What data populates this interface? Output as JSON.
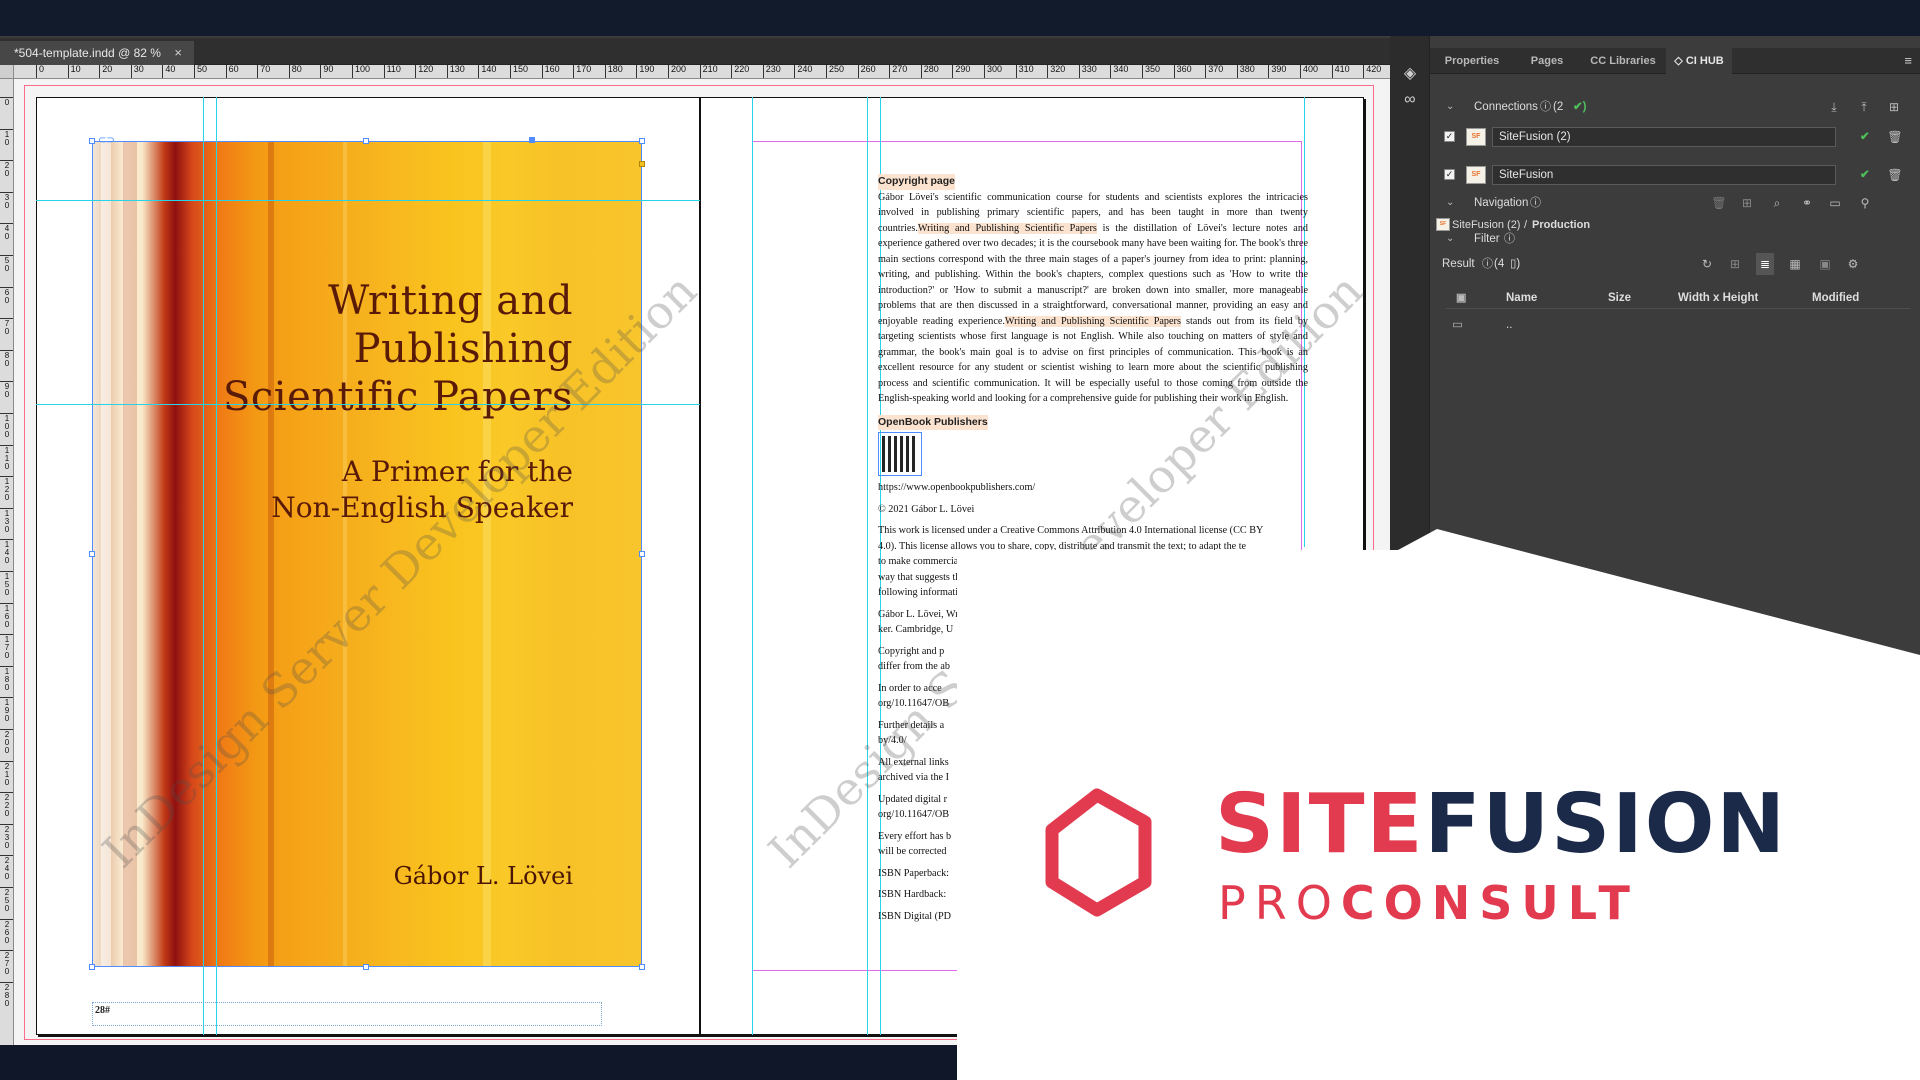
{
  "document_tab": {
    "label": "*504-template.indd @ 82 %",
    "close": "×"
  },
  "ruler": {
    "h_ticks": [
      "0",
      "10",
      "20",
      "30",
      "40",
      "50",
      "60",
      "70",
      "80",
      "90",
      "100",
      "110",
      "120",
      "130",
      "140",
      "150",
      "160",
      "170",
      "180",
      "190",
      "200",
      "210",
      "220",
      "230",
      "240",
      "250",
      "260",
      "270",
      "280",
      "290",
      "300",
      "310",
      "320",
      "330",
      "340",
      "350",
      "360",
      "370",
      "380",
      "390",
      "400",
      "410",
      "420"
    ],
    "v_ticks": [
      "0",
      "1 0",
      "2 0",
      "3 0",
      "4 0",
      "5 0",
      "6 0",
      "7 0",
      "8 0",
      "9 0",
      "1 0 0",
      "1 1 0",
      "1 2 0",
      "1 3 0",
      "1 4 0",
      "1 5 0",
      "1 6 0",
      "1 7 0",
      "1 8 0",
      "1 9 0",
      "2 0 0",
      "2 1 0",
      "2 2 0",
      "2 3 0",
      "2 4 0",
      "2 5 0",
      "2 6 0",
      "2 7 0",
      "2 8 0"
    ]
  },
  "cover": {
    "title_lines": [
      "Writing and",
      "Publishing",
      "Scientific Papers"
    ],
    "subtitle_lines": [
      "A Primer for the",
      "Non-English Speaker"
    ],
    "author": "Gábor L. Lövei",
    "folio": "28#"
  },
  "watermark": "InDesign Server Developer Edition",
  "copyright": {
    "heading": "Copyright page",
    "p1_a": "Gábor Lövei's scientific communication course for students and scientists explores the intricacies involved in publishing primary scientific papers, and has been taught in more than twenty countries.",
    "p1_hl1": "Writing and Publishing Scientific Papers",
    "p1_b": "is the distillation of Lövei's lecture notes and experience gathered over two decades; it is the coursebook many have been waiting for. The book's three main sections correspond with the three main stages of a paper's journey from idea to print: planning, writing, and publishing. Within the book's chapters, complex questions such as 'How to write the introduction?' or 'How to submit a manuscript?' are broken down into smaller, more manageable problems that are then discussed in a straightforward, conversational manner, providing an easy and enjoyable reading experience.",
    "p1_hl2": "Writing and Publishing Scientific Papers",
    "p1_c": "stands out from its field by targeting scientists whose first language is not English. While also touching on matters of style and grammar, the book's main goal is to advise on first principles of communication. This book is an excellent resource for any student or scientist wishing to learn more about the scientific publishing process and scientific communication. It will be especially useful to those coming from outside the English-speaking world and looking for a comprehensive guide for publishing their work in English.",
    "publisher": "OpenBook Publishers",
    "url": "https://www.openbookpublishers.com/",
    "copy": "© 2021 Gábor L. Lövei",
    "license_a": "This work is licensed under a Creative Commons Attribution 4.0 International license (CC BY",
    "license_b": "4.0). This license allows you to share, copy, distribute and transmit the text; to adapt the te",
    "license_c": "to make commercial use of the text providing attribution is made to the auth",
    "license_d": "way that suggests that they endorse you or your use of the work",
    "license_e": "following information:",
    "cite_a": "Gábor L. Lövei, Writing and P",
    "cite_b": "ker. Cambridge, U",
    "rights_a": "Copyright and p",
    "rights_b": "differ from the ab",
    "access_a": "In order to acce",
    "access_b": "org/10.11647/OB",
    "further_a": "Further details a",
    "further_b": "by/4.0/",
    "ext_a": "All external links",
    "ext_b": "archived via the I",
    "upd_a": "Updated digital r",
    "upd_b": "org/10.11647/OB",
    "eff_a": "Every effort has b",
    "eff_b": "will be corrected",
    "isbn1": "ISBN Paperback:",
    "isbn2": "ISBN Hardback:",
    "isbn3": "ISBN Digital (PD"
  },
  "panel": {
    "tabs": [
      "Properties",
      "Pages",
      "CC Libraries",
      "CI HUB"
    ],
    "active_tab": "CI HUB",
    "connections_label": "Connections",
    "connections_count": "(2",
    "connection1": "SiteFusion (2)",
    "connection2": "SiteFusion",
    "badge_text": "SF",
    "navigation_label": "Navigation",
    "path_root": "SiteFusion (2)",
    "path_sep": "/",
    "path_leaf": "Production",
    "filter_label": "Filter",
    "result_label": "Result",
    "result_count": "(4",
    "columns": [
      "Name",
      "Size",
      "Width x Height",
      "Modified"
    ],
    "parent_row": ".."
  },
  "logo": {
    "word1": "SITE",
    "word2": "FUSION",
    "sub1": "PRO",
    "sub2": "CONSULT",
    "red": "#e23a4f",
    "navy": "#1c2a4a"
  }
}
